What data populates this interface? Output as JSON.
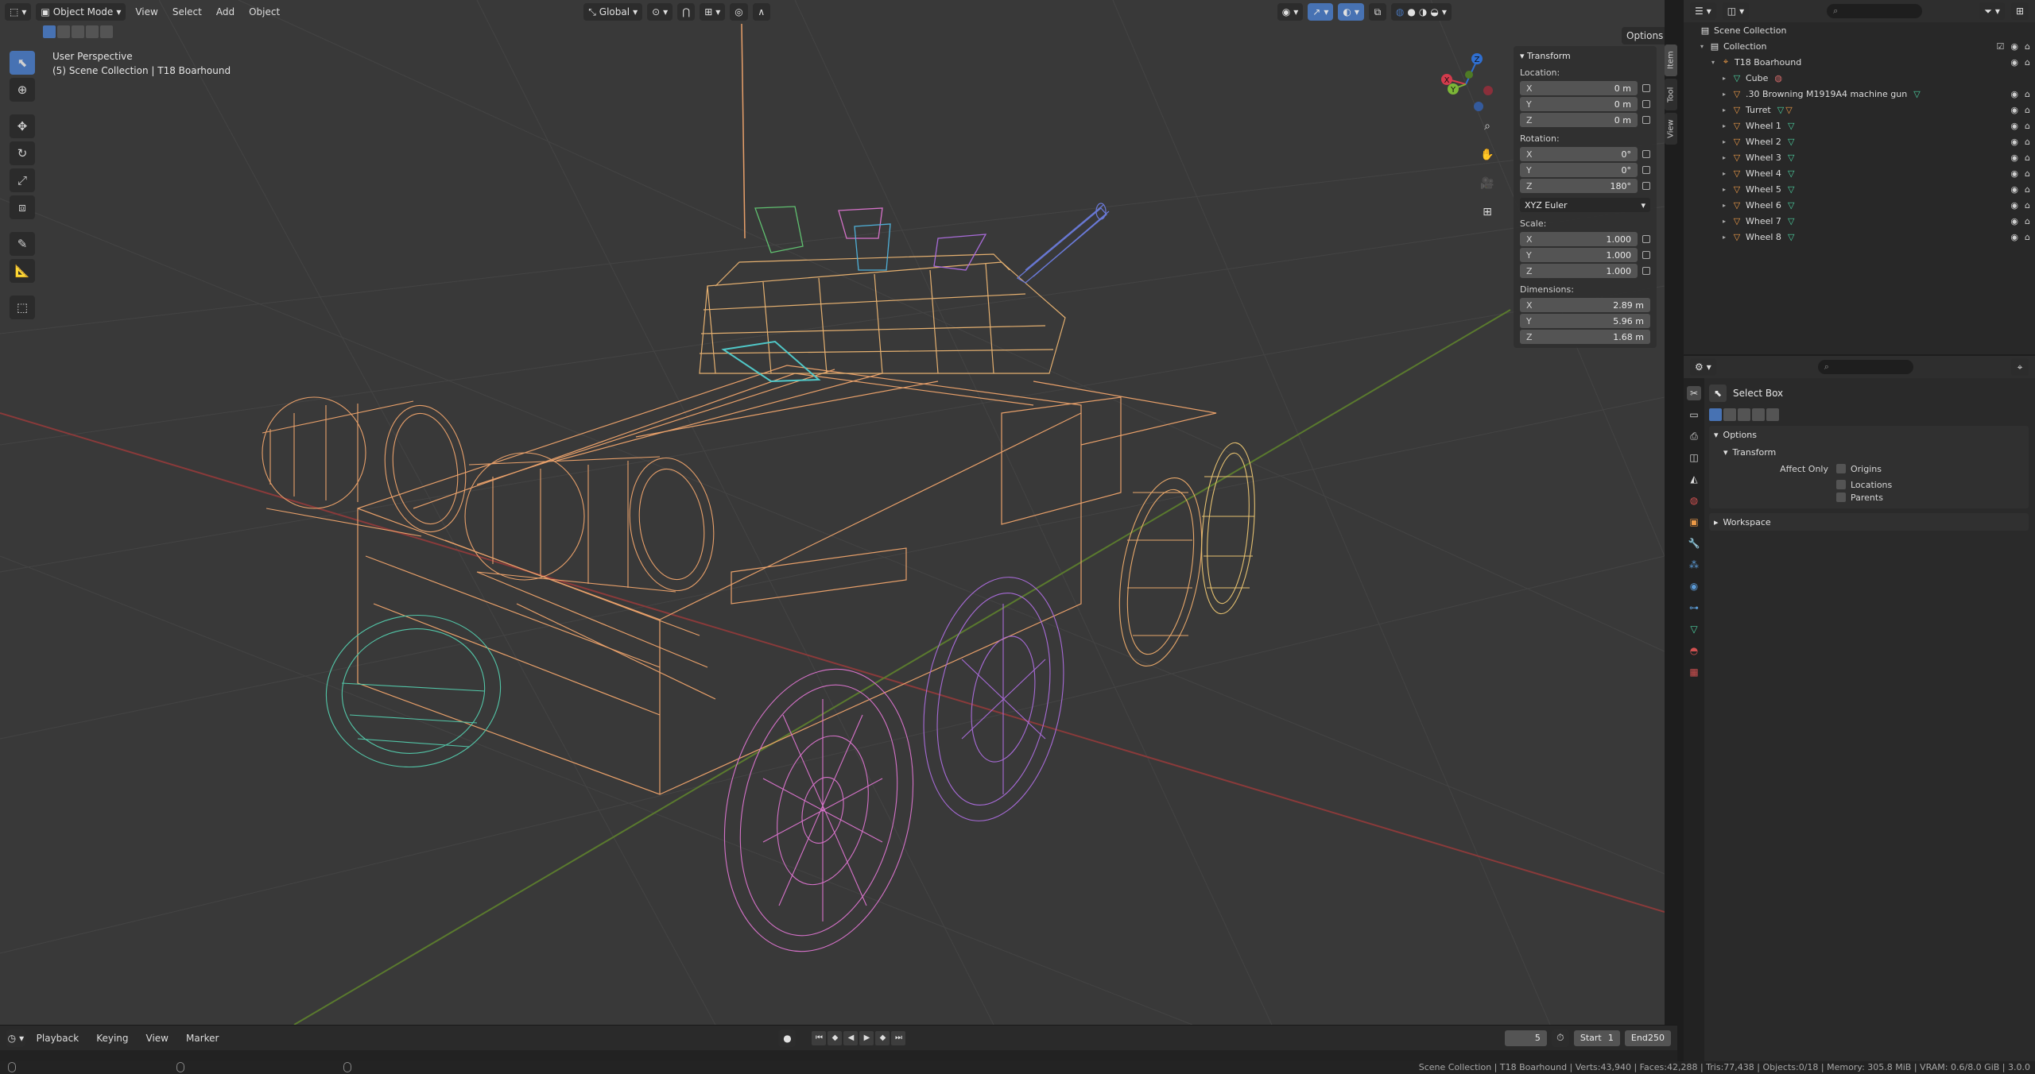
{
  "viewport": {
    "mode": "Object Mode",
    "menus": [
      "View",
      "Select",
      "Add",
      "Object"
    ],
    "orientation": "Global",
    "options_label": "Options",
    "overlay_line1": "User Perspective",
    "overlay_line2": "(5) Scene Collection | T18 Boarhound",
    "side_tabs": [
      "Item",
      "Tool",
      "View"
    ],
    "gizmo": {
      "x": "X",
      "y": "Y",
      "z": "Z"
    }
  },
  "toolbar_icons": [
    "select-box-icon",
    "cursor-icon",
    "move-icon",
    "rotate-icon",
    "scale-icon",
    "transform-icon",
    "annotate-icon",
    "measure-icon",
    "add-cube-icon"
  ],
  "transform_panel": {
    "title": "Transform",
    "location_label": "Location:",
    "location": [
      {
        "axis": "X",
        "value": "0 m"
      },
      {
        "axis": "Y",
        "value": "0 m"
      },
      {
        "axis": "Z",
        "value": "0 m"
      }
    ],
    "rotation_label": "Rotation:",
    "rotation": [
      {
        "axis": "X",
        "value": "0°"
      },
      {
        "axis": "Y",
        "value": "0°"
      },
      {
        "axis": "Z",
        "value": "180°"
      }
    ],
    "rotation_mode": "XYZ Euler",
    "scale_label": "Scale:",
    "scale": [
      {
        "axis": "X",
        "value": "1.000"
      },
      {
        "axis": "Y",
        "value": "1.000"
      },
      {
        "axis": "Z",
        "value": "1.000"
      }
    ],
    "dimensions_label": "Dimensions:",
    "dimensions": [
      {
        "axis": "X",
        "value": "2.89 m"
      },
      {
        "axis": "Y",
        "value": "5.96 m"
      },
      {
        "axis": "Z",
        "value": "1.68 m"
      }
    ]
  },
  "timeline": {
    "menus": [
      "Playback",
      "Keying",
      "View",
      "Marker"
    ],
    "current_frame": "5",
    "start_label": "Start",
    "start": "1",
    "end_label": "End",
    "end": "250"
  },
  "statusbar": {
    "text": "Scene Collection | T18 Boarhound | Verts:43,940 | Faces:42,288 | Tris:77,438 | Objects:0/18 | Memory: 305.8 MiB | VRAM: 0.6/8.0 GiB | 3.0.0"
  },
  "outliner": {
    "rows": [
      {
        "label": "Scene Collection",
        "level": 0,
        "icon": "collection-icon"
      },
      {
        "label": "Collection",
        "level": 1,
        "icon": "collection-icon"
      },
      {
        "label": "T18 Boarhound",
        "level": 2,
        "icon": "empty-icon"
      },
      {
        "label": "Cube",
        "level": 3,
        "icon": "mesh-icon"
      },
      {
        "label": ".30 Browning M1919A4 machine gun",
        "level": 3,
        "icon": "object-icon"
      },
      {
        "label": "Turret",
        "level": 3,
        "icon": "object-icon"
      },
      {
        "label": "Wheel 1",
        "level": 3,
        "icon": "object-icon"
      },
      {
        "label": "Wheel 2",
        "level": 3,
        "icon": "object-icon"
      },
      {
        "label": "Wheel 3",
        "level": 3,
        "icon": "object-icon"
      },
      {
        "label": "Wheel 4",
        "level": 3,
        "icon": "object-icon"
      },
      {
        "label": "Wheel 5",
        "level": 3,
        "icon": "object-icon"
      },
      {
        "label": "Wheel 6",
        "level": 3,
        "icon": "object-icon"
      },
      {
        "label": "Wheel 7",
        "level": 3,
        "icon": "object-icon"
      },
      {
        "label": "Wheel 8",
        "level": 3,
        "icon": "object-icon"
      }
    ]
  },
  "properties": {
    "tool_name": "Select Box",
    "options_label": "Options",
    "transform_label": "Transform",
    "affect_only_label": "Affect Only",
    "checkboxes": [
      "Origins",
      "Locations",
      "Parents"
    ],
    "workspace_label": "Workspace"
  },
  "colors": {
    "accent": "#4772b3",
    "wire_orange": "#e8a06a",
    "wire_pink": "#d672c9",
    "wire_purple": "#a86bd8",
    "wire_teal": "#53c6a8",
    "wire_yellow": "#e5c070"
  }
}
